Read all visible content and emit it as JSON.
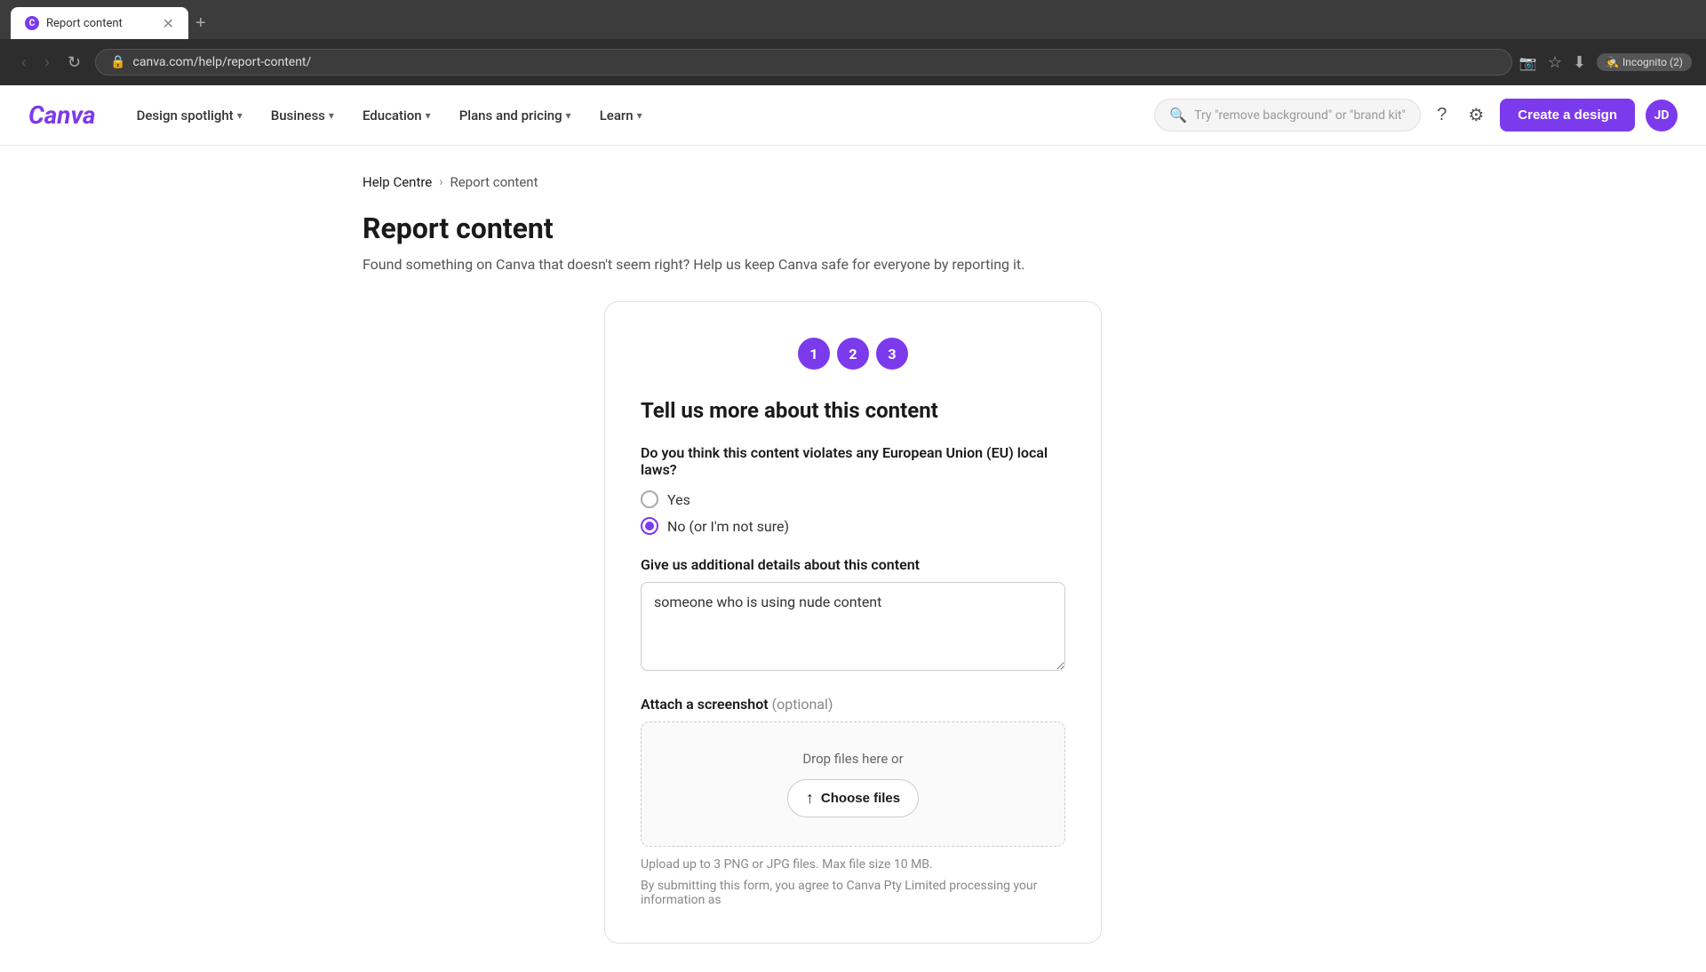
{
  "browser": {
    "tab_title": "Report content",
    "url": "canva.com/help/report-content/",
    "incognito_label": "Incognito (2)"
  },
  "header": {
    "logo": "Canva",
    "nav_items": [
      {
        "label": "Design spotlight",
        "has_chevron": true
      },
      {
        "label": "Business",
        "has_chevron": true
      },
      {
        "label": "Education",
        "has_chevron": true
      },
      {
        "label": "Plans and pricing",
        "has_chevron": true
      },
      {
        "label": "Learn",
        "has_chevron": true
      }
    ],
    "search_placeholder": "Try \"remove background\" or \"brand kit\"",
    "create_btn": "Create a design",
    "user_initials": "JD"
  },
  "breadcrumb": {
    "home": "Help Centre",
    "separator": ">",
    "current": "Report content"
  },
  "page": {
    "title": "Report content",
    "subtitle": "Found something on Canva that doesn't seem right? Help us keep Canva safe for everyone by reporting it."
  },
  "form": {
    "steps": [
      "1",
      "2",
      "3"
    ],
    "heading": "Tell us more about this content",
    "eu_question": "Do you think this content violates any European Union (EU) local laws?",
    "radio_yes": "Yes",
    "radio_no": "No (or I'm not sure)",
    "additional_label": "Give us additional details about this content",
    "textarea_value": "someone who is using nude content",
    "screenshot_label": "Attach a screenshot",
    "screenshot_optional": "(optional)",
    "drop_zone_text": "Drop files here or",
    "choose_files_btn": "Choose files",
    "upload_hint": "Upload up to 3 PNG or JPG files. Max file size 10 MB.",
    "legal_text": "By submitting this form, you agree to Canva Pty Limited processing your information as"
  }
}
